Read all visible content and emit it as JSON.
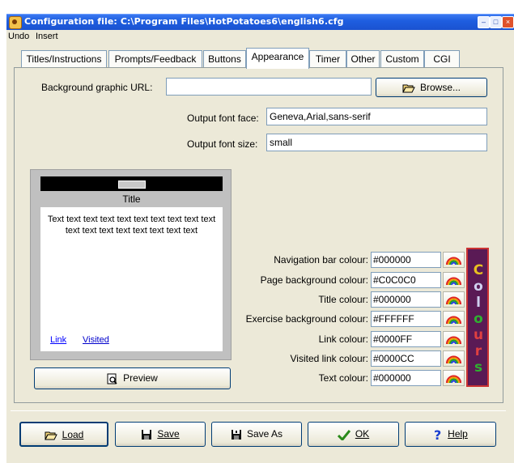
{
  "window": {
    "title": "Configuration file: C:\\Program Files\\HotPotatoes6\\english6.cfg"
  },
  "menu": {
    "items": [
      "Undo",
      "Insert"
    ]
  },
  "tabs": [
    "Titles/Instructions",
    "Prompts/Feedback",
    "Buttons",
    "Appearance",
    "Timer",
    "Other",
    "Custom",
    "CGI"
  ],
  "active_tab": "Appearance",
  "form": {
    "bg_url_label": "Background graphic URL:",
    "bg_url_value": "",
    "browse_label": "Browse...",
    "font_face_label": "Output font face:",
    "font_face_value": "Geneva,Arial,sans-serif",
    "font_size_label": "Output font size:",
    "font_size_value": "small"
  },
  "preview": {
    "title": "Title",
    "text": "Text text text text text text text text text text text text text text text text text text",
    "link": "Link",
    "visited": "Visited",
    "preview_button": "Preview"
  },
  "colours": [
    {
      "label": "Navigation bar colour:",
      "value": "#000000"
    },
    {
      "label": "Page background colour:",
      "value": "#C0C0C0"
    },
    {
      "label": "Title colour:",
      "value": "#000000"
    },
    {
      "label": "Exercise background colour:",
      "value": "#FFFFFF"
    },
    {
      "label": "Link colour:",
      "value": "#0000FF"
    },
    {
      "label": "Visited link colour:",
      "value": "#0000CC"
    },
    {
      "label": "Text colour:",
      "value": "#000000"
    }
  ],
  "colours_logo": [
    "C",
    "o",
    "l",
    "o",
    "u",
    "r",
    "s"
  ],
  "buttons": {
    "load": "Load",
    "save": "Save",
    "save_as": "Save As",
    "ok": "OK",
    "help": "Help"
  },
  "icons": [
    "app-icon",
    "folder-open-icon",
    "magnifier-icon",
    "floppy-icon",
    "floppy-as-icon",
    "checkmark-icon",
    "question-icon",
    "rainbow-icon"
  ]
}
